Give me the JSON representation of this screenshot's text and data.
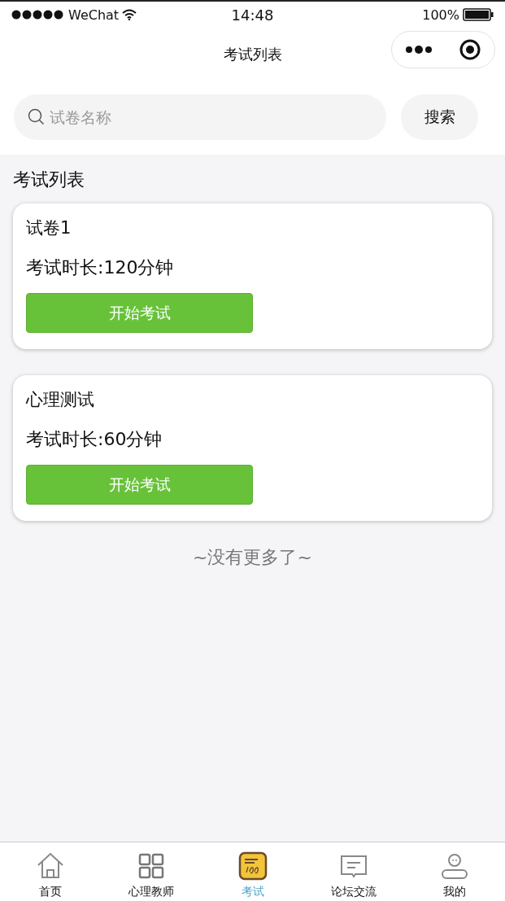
{
  "status_bar": {
    "carrier": "WeChat",
    "time": "14:48",
    "battery": "100%"
  },
  "nav": {
    "title": "考试列表"
  },
  "search": {
    "placeholder": "试卷名称",
    "button": "搜索"
  },
  "section_title": "考试列表",
  "exams": [
    {
      "name": "试卷1",
      "duration": "考试时长:120分钟",
      "button": "开始考试"
    },
    {
      "name": "心理测试",
      "duration": "考试时长:60分钟",
      "button": "开始考试"
    }
  ],
  "end_note": "~没有更多了~",
  "tab_bar": [
    {
      "label": "首页",
      "kind": "home",
      "selected": false
    },
    {
      "label": "心理教师",
      "kind": "grid",
      "selected": false
    },
    {
      "label": "考试",
      "kind": "exam",
      "selected": true
    },
    {
      "label": "论坛交流",
      "kind": "chat",
      "selected": false
    },
    {
      "label": "我的",
      "kind": "user",
      "selected": false
    }
  ]
}
